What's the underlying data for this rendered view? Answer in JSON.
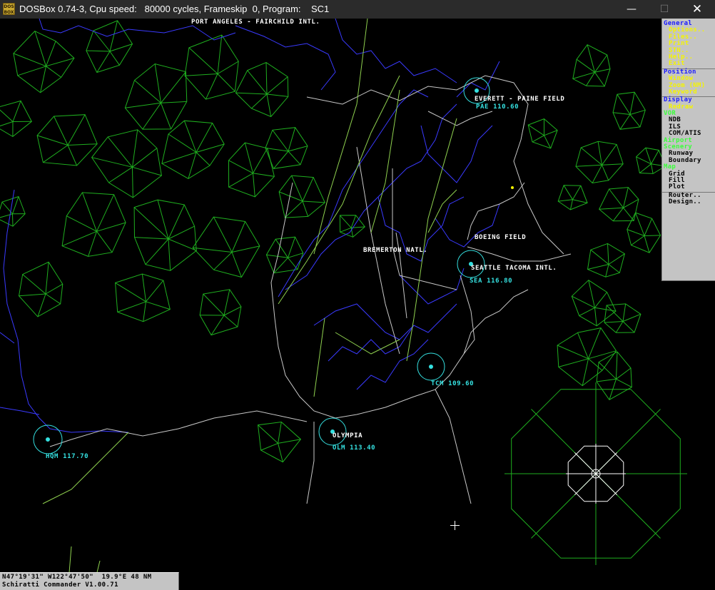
{
  "window": {
    "title": "DOSBox 0.74-3, Cpu speed:   80000 cycles, Frameskip  0, Program:    SC1",
    "icon_label": "DOS BOX",
    "minimize": "—",
    "maximize": "☐",
    "close": "✕"
  },
  "map_labels": {
    "port_angeles": "PORT ANGELES - FAIRCHILD INTL.",
    "everett": "EVERETT - PAINE FIELD",
    "pae": "PAE 110.60",
    "boeing": "BOEING FIELD",
    "bremerton": "BREMERTON NATL.",
    "seatac": "SEATTLE TACOMA INTL.",
    "sea": "SEA 116.80",
    "tcm": "TCM 109.60",
    "olympia": "OLYMPIA",
    "olm": "OLM 113.40",
    "hqm": "HQM 117.70"
  },
  "menu": {
    "general": "General",
    "options": "Options..",
    "files": "Files..",
    "print": "Print",
    "stn": "STN..",
    "help": "Help..",
    "exit": "Exit",
    "position": "Position",
    "window_item": "Window",
    "zoom": "Zoom (NM)",
    "keyword": "Keyword",
    "display": "Display",
    "redraw": "Redraw",
    "vor": "VOR",
    "ndb": "NDB",
    "ils": "ILS",
    "comatis": "COM/ATIS",
    "airport": "Airport",
    "scenery": "Scenery",
    "runway": "Runway",
    "boundary": "Boundary",
    "map": "Map",
    "grid": "Grid",
    "fill": "Fill",
    "plot": "Plot",
    "router": "Router..",
    "design": "Design.."
  },
  "status": {
    "coords": "N47°19'31\" W122°47'50\"  19.9°E 48 NM",
    "version": "Schiratti Commander V1.00.71"
  },
  "colors": {
    "scenery": "#1fae1f",
    "coastline": "#3a3aff",
    "boundary": "#c8c8c8",
    "vor": "#35e0e0",
    "menu_bg": "#c4c4c4"
  }
}
